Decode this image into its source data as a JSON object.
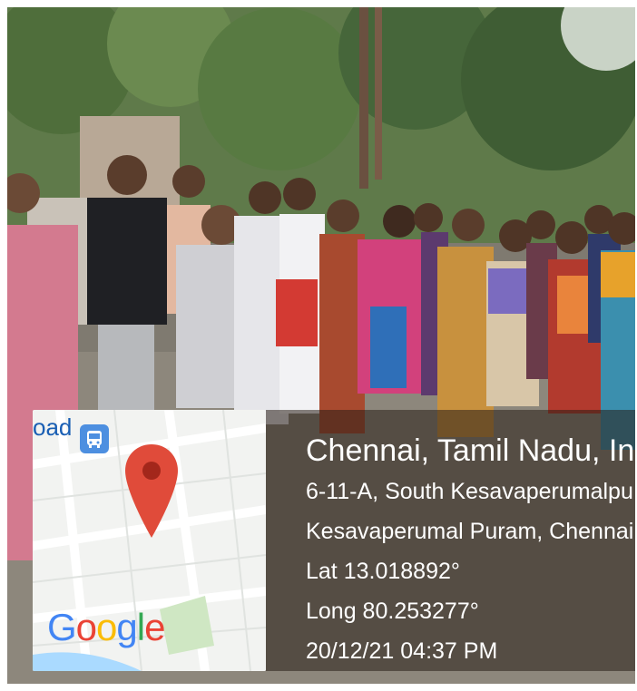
{
  "map": {
    "road_label_fragment": "oad",
    "icons": [
      "bus-icon",
      "map-pin-icon"
    ],
    "pin_color": "#e04b3a",
    "bus_color": "#4d8fe0",
    "logo": {
      "letters": [
        "G",
        "o",
        "o",
        "g",
        "l",
        "e"
      ],
      "colors": [
        "#4285f4",
        "#ea4335",
        "#fbbc05",
        "#4285f4",
        "#34a853",
        "#ea4335"
      ]
    }
  },
  "geotag": {
    "location_title": "Chennai, Tamil Nadu, In",
    "address_line1": "6-11-A, South Kesavaperumalpu",
    "address_line2": "Kesavaperumal Puram, Chennai,",
    "latitude": "Lat 13.018892°",
    "longitude": "Long 80.253277°",
    "timestamp": "20/12/21 04:37 PM"
  },
  "scene": {
    "description_colors": {
      "foliage": "#4e6b3a",
      "ground": "#8a8478",
      "sky": "#cfd6cf"
    }
  }
}
